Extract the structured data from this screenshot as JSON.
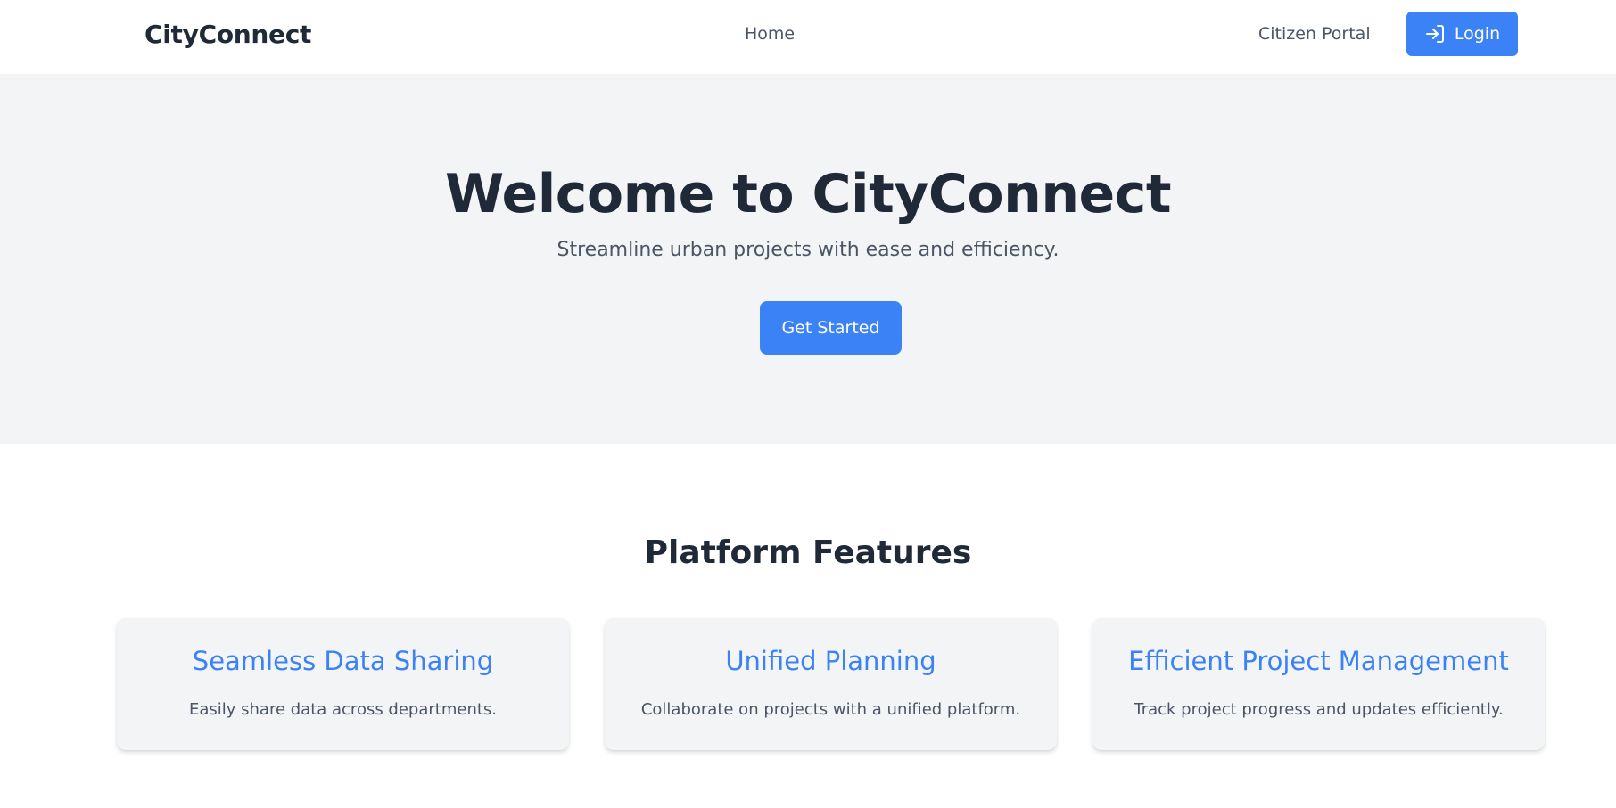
{
  "navbar": {
    "brand": "CityConnect",
    "home_label": "Home",
    "portal_label": "Citizen Portal",
    "login_label": "Login",
    "login_icon": "log-in-icon"
  },
  "hero": {
    "title": "Welcome to CityConnect",
    "subtitle": "Streamline urban projects with ease and efficiency.",
    "cta_label": "Get Started"
  },
  "features": {
    "title": "Platform Features",
    "items": [
      {
        "title": "Seamless Data Sharing",
        "description": "Easily share data across departments."
      },
      {
        "title": "Unified Planning",
        "description": "Collaborate on projects with a unified platform."
      },
      {
        "title": "Efficient Project Management",
        "description": "Track project progress and updates efficiently."
      }
    ]
  },
  "colors": {
    "accent": "#3b82f6",
    "hero_bg": "#f3f4f6",
    "heading": "#1f2937",
    "body_text": "#4b5563"
  }
}
